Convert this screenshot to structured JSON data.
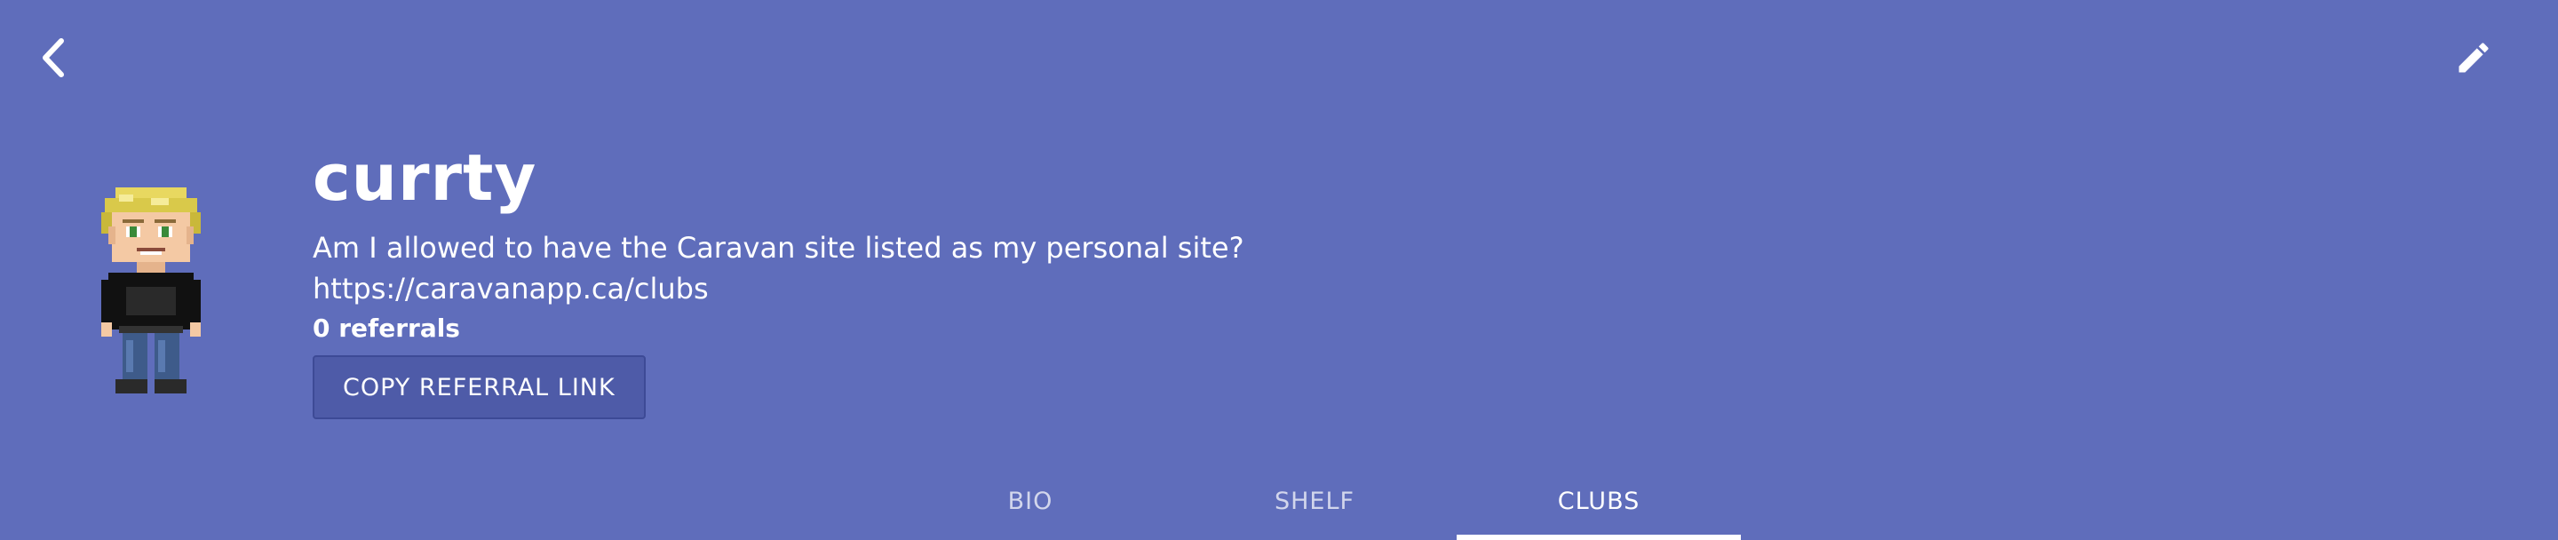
{
  "header": {
    "back_icon": "chevron-left-icon",
    "edit_icon": "pencil-icon",
    "background_color": "#5f6dbb"
  },
  "profile": {
    "username": "currty",
    "bio": "Am I allowed to have the Caravan site listed as my personal site?",
    "website": "https://caravanapp.ca/clubs",
    "referrals": "0 referrals",
    "copy_button_label": "COPY REFERRAL LINK",
    "avatar_icon": "pixel-avatar"
  },
  "tabs": [
    {
      "label": "BIO",
      "active": false
    },
    {
      "label": "SHELF",
      "active": false
    },
    {
      "label": "CLUBS",
      "active": true
    }
  ]
}
